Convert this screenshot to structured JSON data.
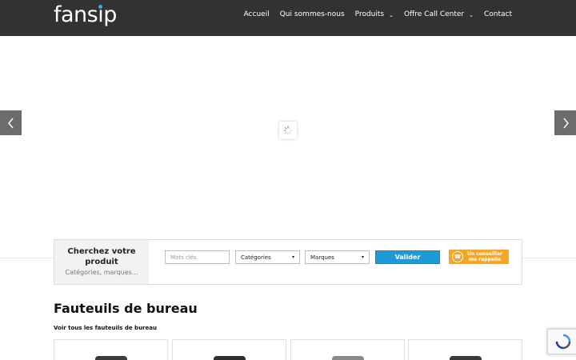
{
  "header": {
    "logo_text": "fansip",
    "nav": [
      {
        "label": "Accueil",
        "has_dropdown": false
      },
      {
        "label": "Qui sommes-nous",
        "has_dropdown": false
      },
      {
        "label": "Produits",
        "has_dropdown": true
      },
      {
        "label": "Offre Call Center",
        "has_dropdown": true
      },
      {
        "label": "Contact",
        "has_dropdown": false
      }
    ]
  },
  "slider": {
    "prev_icon": "chevron-left-icon",
    "next_icon": "chevron-right-icon",
    "loading_icon": "spinner-icon"
  },
  "search": {
    "title": "Cherchez votre produit",
    "subtitle": "Catégories, marques...",
    "keywords_placeholder": "Mots clés",
    "category_selected": "Catégories",
    "brand_selected": "Marques",
    "submit_label": "Valider",
    "callback_line1": "Un conseiller",
    "callback_line2": "me rappelle"
  },
  "section": {
    "title": "Fauteuils de bureau",
    "link": "Voir tous les fauteuils de bureau"
  },
  "colors": {
    "header_bg": "#323232",
    "accent_blue": "#1e9bd7",
    "accent_orange": "#f5a623"
  }
}
